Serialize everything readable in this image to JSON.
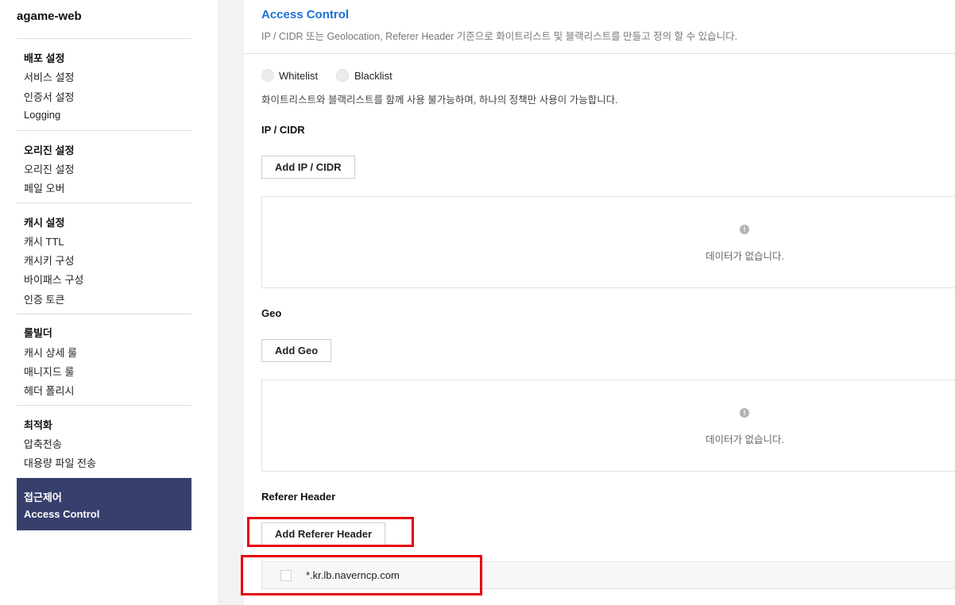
{
  "app": {
    "title": "agame-web"
  },
  "sidebar": {
    "groups": [
      {
        "title": "배포 설정",
        "items": [
          "서비스 설정",
          "인증서 설정",
          "Logging"
        ]
      },
      {
        "title": "오리진 설정",
        "items": [
          "오리진 설정",
          "페일 오버"
        ]
      },
      {
        "title": "캐시 설정",
        "items": [
          "캐시 TTL",
          "캐시키 구성",
          "바이패스 구성",
          "인증 토큰"
        ]
      },
      {
        "title": "룰빌더",
        "items": [
          "캐시 상세 룰",
          "매니지드 룰",
          "헤더 폴리시"
        ]
      },
      {
        "title": "최적화",
        "items": [
          "압축전송",
          "대용량 파일 전송"
        ]
      }
    ],
    "active": {
      "title": "접근제어",
      "item": "Access Control"
    }
  },
  "main": {
    "title": "Access Control",
    "description": "IP / CIDR 또는 Geolocation, Referer Header 기준으로 화이트리스트 및 블랙리스트를 만들고 정의 할 수 있습니다.",
    "mode": {
      "options": [
        "Whitelist",
        "Blacklist"
      ],
      "note": "화이트리스트와 블랙리스트를 함께 사용 불가능하며, 하나의 정책만 사용이 가능합니다."
    },
    "sections": {
      "ip": {
        "title": "IP / CIDR",
        "button": "Add IP / CIDR",
        "empty": "데이터가 없습니다."
      },
      "geo": {
        "title": "Geo",
        "button": "Add Geo",
        "empty": "데이터가 없습니다."
      },
      "referer": {
        "title": "Referer Header",
        "button": "Add Referer Header",
        "rows": [
          "*.kr.lb.naverncp.com"
        ]
      }
    }
  },
  "icons": {
    "info": "info-icon"
  },
  "colors": {
    "accent": "#1b72d6",
    "active_nav": "#373f6c",
    "highlight": "#e8000b"
  }
}
